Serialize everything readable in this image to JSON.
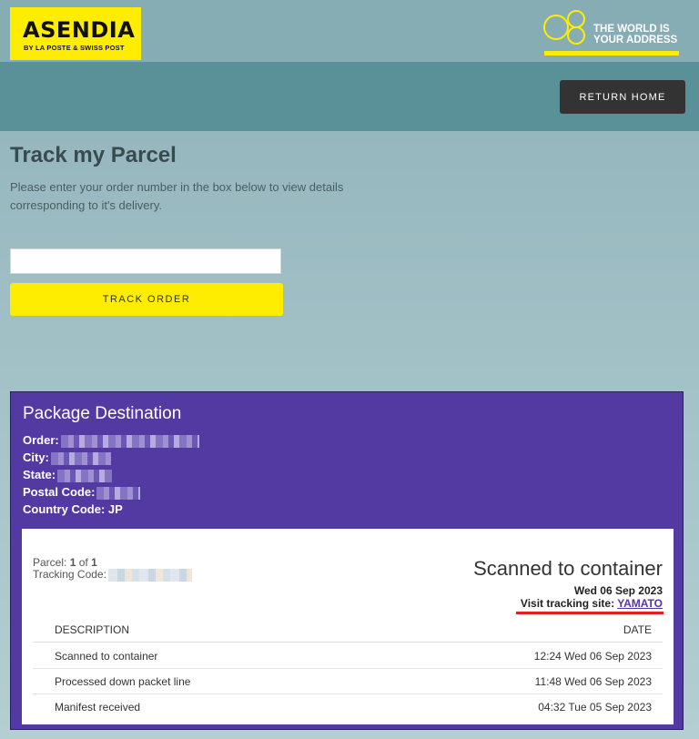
{
  "brand": {
    "logo_main": "ASENDIA",
    "logo_sub": "BY LA POSTE & SWISS POST",
    "tagline_line1": "THE WORLD IS",
    "tagline_line2": "YOUR ADDRESS",
    "accent_yellow": "#ffed00",
    "accent_purple": "#533aa2"
  },
  "nav": {
    "return_home": "RETURN HOME"
  },
  "page": {
    "title": "Track my Parcel",
    "intro": "Please enter your order number in the box below to view details corresponding to it's delivery.",
    "order_input_value": "",
    "track_button": "TRACK ORDER"
  },
  "destination": {
    "title": "Package Destination",
    "order_label": "Order:",
    "city_label": "City:",
    "state_label": "State:",
    "postal_label": "Postal Code:",
    "country_label": "Country Code:",
    "country_value": "JP"
  },
  "parcel": {
    "parcel_label": "Parcel:",
    "parcel_index": "1",
    "parcel_of": "of",
    "parcel_total": "1",
    "tracking_label": "Tracking Code:",
    "status": "Scanned to container",
    "status_date": "Wed 06 Sep 2023",
    "visit_label": "Visit tracking site:",
    "visit_link": "YAMATO"
  },
  "events": {
    "headers": {
      "description": "DESCRIPTION",
      "date": "DATE"
    },
    "rows": [
      {
        "description": "Scanned to container",
        "date": "12:24 Wed 06 Sep 2023"
      },
      {
        "description": "Processed down packet line",
        "date": "11:48 Wed 06 Sep 2023"
      },
      {
        "description": "Manifest received",
        "date": "04:32 Tue 05 Sep 2023"
      }
    ]
  }
}
